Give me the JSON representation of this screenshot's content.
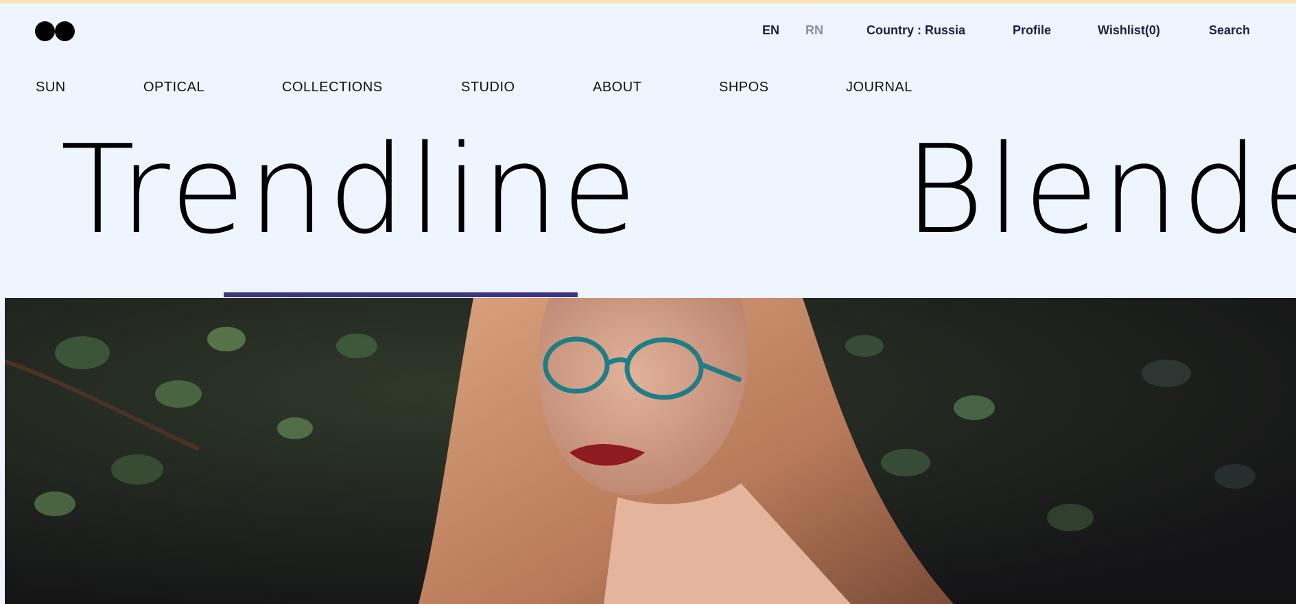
{
  "lang": {
    "en": "EN",
    "rn": "RN"
  },
  "util_nav": {
    "country": "Country : Russia",
    "profile": "Profile",
    "wishlist": "Wishlist(0)",
    "search": "Search"
  },
  "main_nav": [
    "SUN",
    "OPTICAL",
    "COLLECTIONS",
    "STUDIO",
    "ABOUT",
    "SHPOS",
    "JOURNAL"
  ],
  "slider": {
    "titles": [
      "Trendline",
      "Blende"
    ],
    "active_index": 0
  },
  "colors": {
    "background": "#eef5ff",
    "top_strip": "#fde2b8",
    "accent": "#3d3580",
    "text_dark": "#1c1f44",
    "text_muted": "#8a8f99"
  },
  "hero_image": {
    "icon": "photo-icon"
  }
}
